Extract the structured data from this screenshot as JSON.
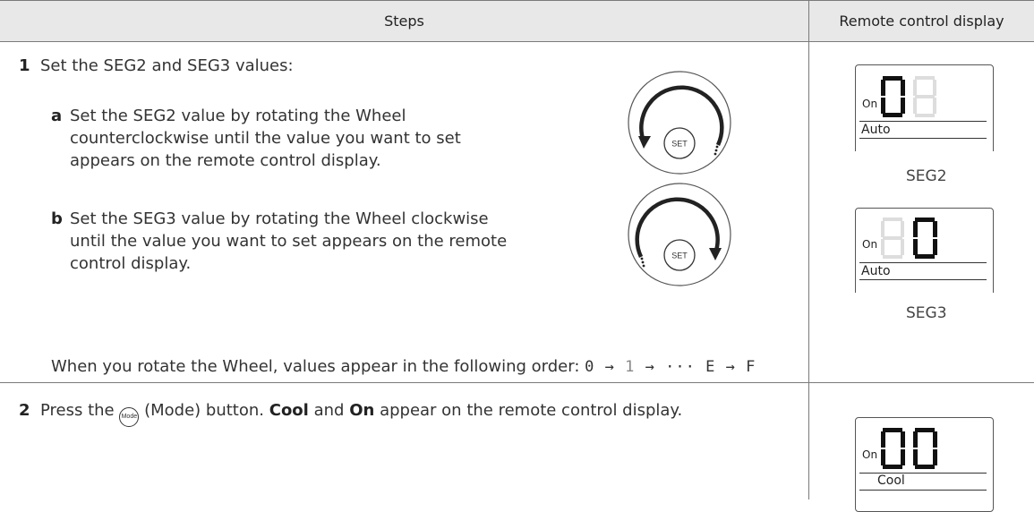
{
  "table": {
    "col_steps": "Steps",
    "col_display": "Remote control display"
  },
  "step1": {
    "number": "1",
    "text": "Set the SEG2 and SEG3 values:",
    "a_letter": "a",
    "a_line1": "Set the SEG2 value by rotating the Wheel",
    "a_line2": "counterclockwise until the value you want to set",
    "a_line3": "appears on the remote control display.",
    "b_letter": "b",
    "b_line1": "Set the SEG3 value by rotating the Wheel clockwise",
    "b_line2": "until the value you want to set appears on the remote",
    "b_line3": "control display.",
    "order_text": "When you rotate the Wheel, values appear in the following order:",
    "order_sequence": [
      "0",
      "1",
      "E",
      "F"
    ],
    "ellipsis": "···",
    "wheel_label": "SET",
    "display_seg2": {
      "on": "On",
      "mode": "Auto",
      "caption": "SEG2"
    },
    "display_seg3": {
      "on": "On",
      "mode": "Auto",
      "caption": "SEG3"
    }
  },
  "step2": {
    "number": "2",
    "before": "Press the",
    "icon_label": "Mode",
    "after1": "(Mode) button.",
    "bold1": "Cool",
    "and": "and",
    "bold2": "On",
    "after2": "appear on the remote control display.",
    "display": {
      "on": "On",
      "mode": "Cool"
    }
  }
}
